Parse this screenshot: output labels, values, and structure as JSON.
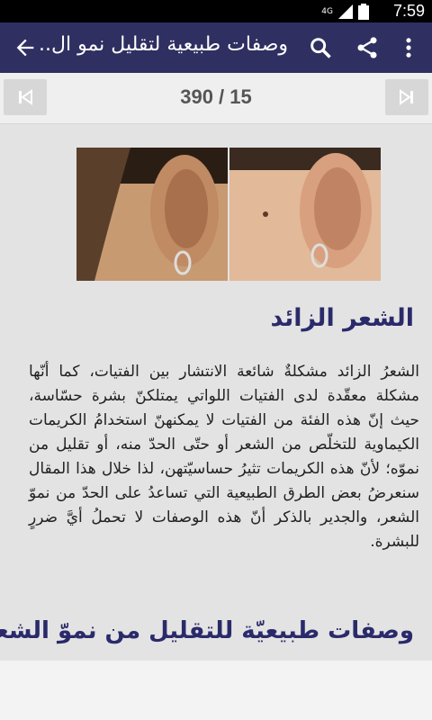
{
  "status_bar": {
    "time": "7:59",
    "network": "4G"
  },
  "app_bar": {
    "title": "وصفات طبيعية لتقليل نمو ال..",
    "icons": [
      "arrow-back-icon",
      "search-icon",
      "share-icon",
      "more-vert-icon"
    ]
  },
  "pager": {
    "label": "390 / 15"
  },
  "article": {
    "heading": "الشعر الزائد",
    "paragraph": "الشعرُ الزائد مشكلةٌ شائعة الانتشار بين الفتيات، كما أنّها مشكلة معقّدة لدى الفتيات اللواتي يمتلكنّ بشرة حسّاسة، حيث إنّ هذه الفئة من الفتيات لا يمكنهنّ استخدامُ الكريمات الكيماوية للتخلّص من الشعر أو حتّى الحدّ منه، أو تقليل من نموّه؛ لأنّ هذه الكريمات تثيرُ حساسيّتهن، لذا خلال هذا المقال سنعرضُ بعض الطرق الطبيعية التي تساعدُ على الحدّ من نموّ الشعر، والجدير بالذكر أنّ هذه الوصفات لا تحملُ أيَّ ضررٍ للبشرة.",
    "subheading": "وصفات طبيعيّة للتقليل من نموّ الشعر"
  },
  "colors": {
    "app_bar": "#2f2f62",
    "heading": "#2a2a6b"
  }
}
